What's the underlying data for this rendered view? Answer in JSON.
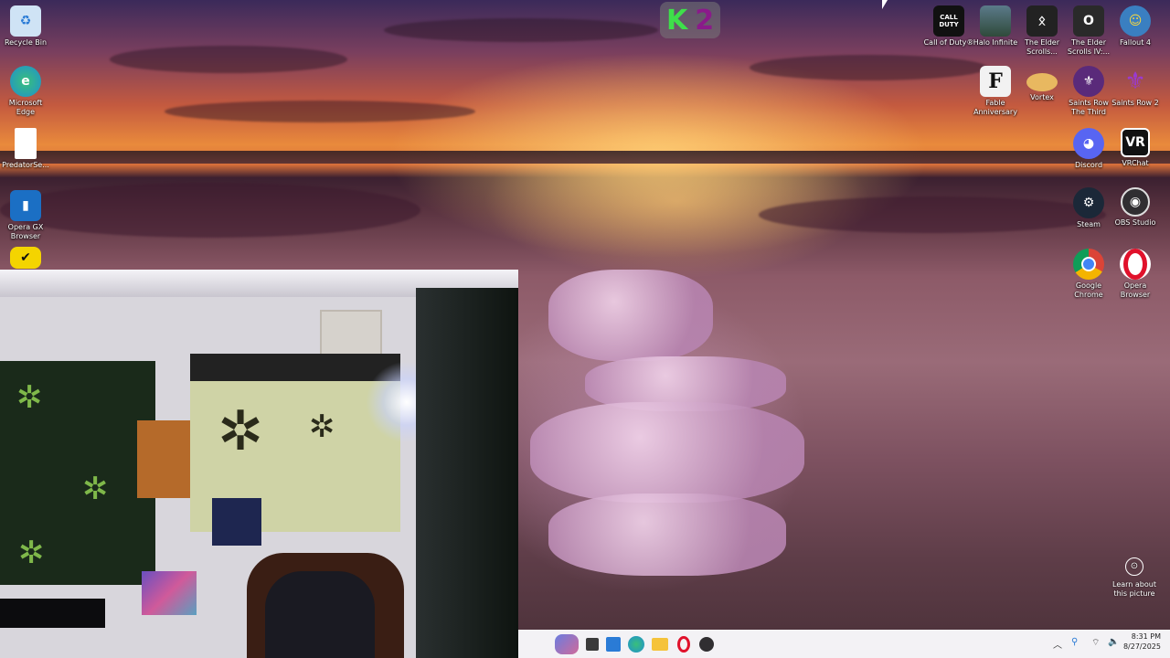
{
  "overlay": {
    "k_letter": "K",
    "number": "2"
  },
  "desktop_left": [
    {
      "id": "recycle",
      "label": "Recycle Bin",
      "icon": "recycle-bin-icon",
      "color": "#cfe3f5"
    },
    {
      "id": "edge",
      "label": "Microsoft Edge",
      "icon": "edge-icon",
      "color": "#1f8fd1"
    },
    {
      "id": "predator",
      "label": "PredatorSe...",
      "icon": "document-icon",
      "color": "#ffffff"
    },
    {
      "id": "operagx",
      "label": "Opera GX Browser",
      "icon": "opera-gx-icon",
      "color": "#1b6fc4"
    },
    {
      "id": "norton",
      "label": "",
      "icon": "check-icon",
      "color": "#f4d400"
    }
  ],
  "desktop_right": [
    {
      "id": "cod",
      "label": "Call of Duty®",
      "icon": "cod-icon",
      "color": "#111111",
      "glyph": "CALL OF DUTY"
    },
    {
      "id": "halo",
      "label": "Halo Infinite",
      "icon": "halo-icon",
      "color": "#5b7a8a",
      "glyph": ""
    },
    {
      "id": "skyrim",
      "label": "The Elder Scrolls...",
      "icon": "skyrim-icon",
      "color": "#222222",
      "glyph": "ᛟ"
    },
    {
      "id": "oblivion",
      "label": "The Elder Scrolls IV:...",
      "icon": "oblivion-icon",
      "color": "#2a2a2a",
      "glyph": "O"
    },
    {
      "id": "fallout",
      "label": "Fallout 4",
      "icon": "fallout-icon",
      "color": "#3a7fc1",
      "glyph": "☺"
    },
    {
      "id": "fable",
      "label": "Fable Anniversary",
      "icon": "fable-icon",
      "color": "#f2f2f2",
      "glyph": "F"
    },
    {
      "id": "vortex",
      "label": "Vortex",
      "icon": "vortex-icon",
      "color": "#e8b860",
      "glyph": "🌀"
    },
    {
      "id": "sr3",
      "label": "Saints Row The Third",
      "icon": "saints-row-3-icon",
      "color": "#5a2a7a",
      "glyph": "⚜"
    },
    {
      "id": "sr2",
      "label": "Saints Row 2",
      "icon": "saints-row-2-icon",
      "color": "#6a2a9a",
      "glyph": "⚜"
    },
    {
      "id": "discord",
      "label": "Discord",
      "icon": "discord-icon",
      "color": "#5865f2",
      "glyph": "◕"
    },
    {
      "id": "vrchat",
      "label": "VRChat",
      "icon": "vrchat-icon",
      "color": "#111111",
      "glyph": "VR"
    },
    {
      "id": "steam",
      "label": "Steam",
      "icon": "steam-icon",
      "color": "#1b2838",
      "glyph": "⚙"
    },
    {
      "id": "obs",
      "label": "OBS Studio",
      "icon": "obs-icon",
      "color": "#302e31",
      "glyph": "◉"
    },
    {
      "id": "chrome",
      "label": "Google Chrome",
      "icon": "chrome-icon",
      "color": "#ffffff",
      "glyph": "◎"
    },
    {
      "id": "opera",
      "label": "Opera Browser",
      "icon": "opera-icon",
      "color": "#ffffff",
      "glyph": "O"
    }
  ],
  "learn": {
    "label": "Learn about this picture"
  },
  "taskbar": {
    "icons": [
      "copilot-icon",
      "task-view-icon",
      "store-icon",
      "edge-icon",
      "file-explorer-icon",
      "opera-icon",
      "obs-icon"
    ],
    "time": "8:31 PM",
    "date": "8/27/2025"
  }
}
